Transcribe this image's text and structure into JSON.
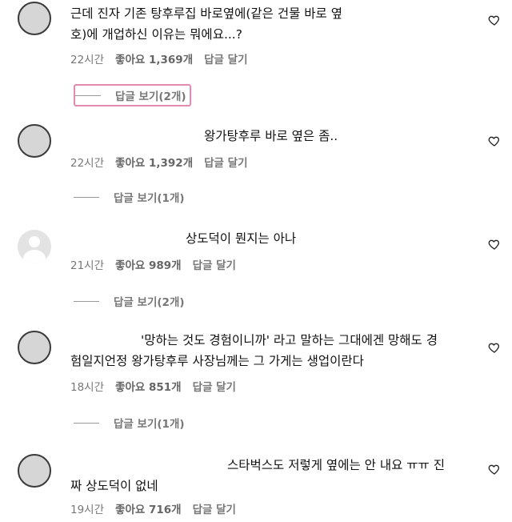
{
  "comments": [
    {
      "text": "근데 진자 기존 탕후루집 바로옆에(같은 건물 바로 옆\n호)에 개업하신 이유는 뭐에요...?",
      "time": "22시간",
      "likes": "좋아요 1,369개",
      "reply": "답글 달기",
      "view_replies": "답글 보기(2개)"
    },
    {
      "text": "왕가탕후루 바로 옆은 좀..",
      "time": "22시간",
      "likes": "좋아요 1,392개",
      "reply": "답글 달기",
      "view_replies": "답글 보기(1개)"
    },
    {
      "text": "상도덕이 뭔지는 아나",
      "time": "21시간",
      "likes": "좋아요 989개",
      "reply": "답글 달기",
      "view_replies": "답글 보기(2개)"
    },
    {
      "text": "'망하는 것도 경험이니까' 라고 말하는 그대에겐 망해도 경\n험일지언정 왕가탕후루 사장님께는 그 가게는 생업이란다",
      "time": "18시간",
      "likes": "좋아요 851개",
      "reply": "답글 달기",
      "view_replies": "답글 보기(1개)"
    },
    {
      "text": "스타벅스도 저렇게 옆에는 안 내요 ㅠㅠ 진\n짜 상도덕이 없네",
      "time": "19시간",
      "likes": "좋아요 716개",
      "reply": "답글 달기"
    }
  ],
  "icons": {
    "like": "heart-outline-icon",
    "avatar": "avatar"
  },
  "colors": {
    "highlight_box": "#e48ab0",
    "meta_text": "#777777"
  }
}
